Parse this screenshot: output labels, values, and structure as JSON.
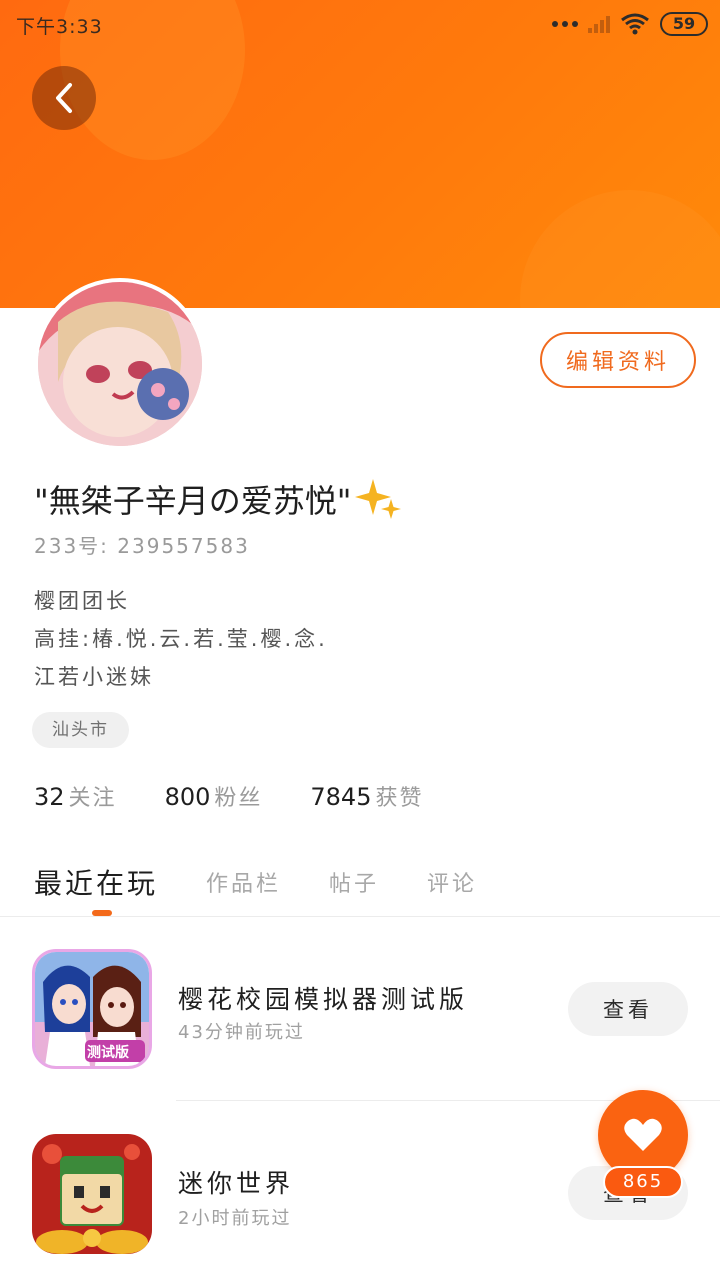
{
  "status_bar": {
    "time": "下午3:33",
    "battery": "59"
  },
  "profile": {
    "nickname": "\"無桀子辛月の爱苏悦\"",
    "uid": "233号: 239557583",
    "bio_lines": [
      "樱团团长",
      "高挂:椿.悦.云.若.莹.樱.念.",
      "江若小迷妹"
    ],
    "location": "汕头市",
    "edit_label": "编辑资料"
  },
  "stats": [
    {
      "value": "32",
      "label": "关注"
    },
    {
      "value": "800",
      "label": "粉丝"
    },
    {
      "value": "7845",
      "label": "获赞"
    }
  ],
  "tabs": [
    {
      "label": "最近在玩",
      "active": true
    },
    {
      "label": "作品栏",
      "active": false
    },
    {
      "label": "帖子",
      "active": false
    },
    {
      "label": "评论",
      "active": false
    }
  ],
  "games": [
    {
      "name": "樱花校园模拟器测试版",
      "last_played": "43分钟前玩过",
      "action": "查看",
      "badge": "测试版"
    },
    {
      "name": "迷你世界",
      "last_played": "2小时前玩过",
      "action": "查看"
    }
  ],
  "like_button": {
    "count": "865",
    "icon": "heart-icon"
  },
  "colors": {
    "accent": "#fa6311",
    "banner": "#ff7a0c"
  }
}
